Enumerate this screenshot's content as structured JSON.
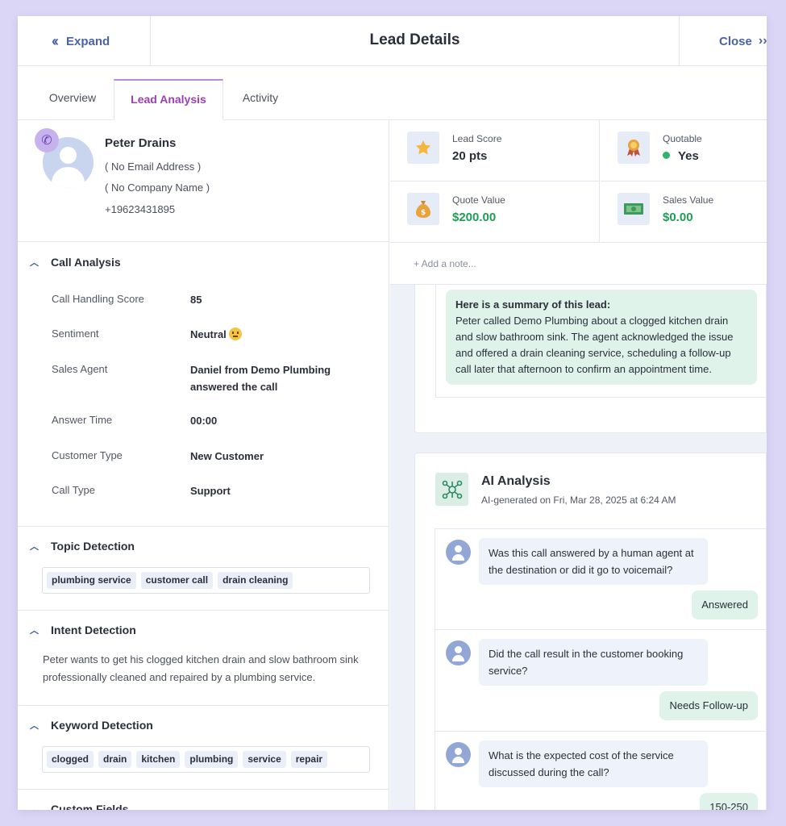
{
  "header": {
    "expand_label": "Expand",
    "title": "Lead Details",
    "close_label": "Close"
  },
  "tabs": [
    {
      "label": "Overview",
      "active": false
    },
    {
      "label": "Lead Analysis",
      "active": true
    },
    {
      "label": "Activity",
      "active": false
    }
  ],
  "contact": {
    "name": "Peter Drains",
    "email": "( No Email Address )",
    "company": "( No Company Name )",
    "phone": "+19623431895"
  },
  "call_analysis": {
    "title": "Call Analysis",
    "rows": [
      {
        "label": "Call Handling Score",
        "value": "85"
      },
      {
        "label": "Sentiment",
        "value": "Neutral"
      },
      {
        "label": "Sales Agent",
        "value": "Daniel from Demo Plumbing answered the call"
      },
      {
        "label": "Answer Time",
        "value": "00:00"
      },
      {
        "label": "Customer Type",
        "value": "New Customer"
      },
      {
        "label": "Call Type",
        "value": "Support"
      }
    ]
  },
  "topic_detection": {
    "title": "Topic Detection",
    "topics": [
      "plumbing service",
      "customer call",
      "drain cleaning"
    ]
  },
  "intent_detection": {
    "title": "Intent Detection",
    "text": "Peter wants to get his clogged kitchen drain and slow bathroom sink professionally cleaned and repaired by a plumbing service."
  },
  "keyword_detection": {
    "title": "Keyword Detection",
    "keywords": [
      "clogged",
      "drain",
      "kitchen",
      "plumbing",
      "service",
      "repair"
    ]
  },
  "custom_fields": {
    "title": "Custom Fields"
  },
  "stats": {
    "lead_score": {
      "label": "Lead Score",
      "value": "20 pts"
    },
    "quotable": {
      "label": "Quotable",
      "value": "Yes"
    },
    "quote_value": {
      "label": "Quote Value",
      "value": "$200.00"
    },
    "sales_value": {
      "label": "Sales Value",
      "value": "$0.00"
    }
  },
  "note_placeholder": "+ Add a note...",
  "summary": {
    "heading": "Here is a summary of this lead:",
    "text": "Peter called Demo Plumbing about a clogged kitchen drain and slow bathroom sink. The agent acknowledged the issue and offered a drain cleaning service, scheduling a follow-up call later that afternoon to confirm an appointment time."
  },
  "ai_analysis": {
    "title": "AI Analysis",
    "subtitle": "AI-generated on Fri, Mar 28, 2025 at 6:24 AM",
    "qa": [
      {
        "question": "Was this call answered by a human agent at the destination or did it go to voicemail?",
        "answer": "Answered"
      },
      {
        "question": "Did the call result in the customer booking service?",
        "answer": "Needs Follow-up"
      },
      {
        "question": "What is the expected cost of the service discussed during the call?",
        "answer": "150-250"
      }
    ]
  },
  "colors": {
    "accent_purple": "#9b3fb8",
    "link_blue": "#4a63a8",
    "money_green": "#1f9d55",
    "answer_bubble": "#dff3ea"
  }
}
